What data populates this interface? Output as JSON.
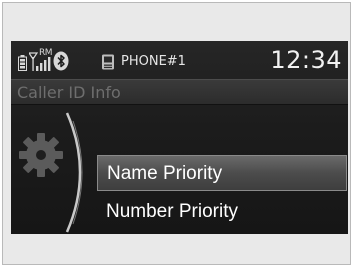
{
  "status_bar": {
    "roam_label": "RM",
    "phone_name": "PHONE#1",
    "time": "12:34",
    "icons": [
      "battery-icon",
      "signal-icon",
      "bluetooth-icon",
      "phone-icon"
    ]
  },
  "screen": {
    "title": "Caller ID Info",
    "settings_icon": "gear-icon"
  },
  "menu": {
    "items": [
      {
        "label": "Name Priority",
        "selected": true
      },
      {
        "label": "Number Priority",
        "selected": false
      }
    ]
  },
  "colors": {
    "screen_background": "#1c1c1c",
    "highlight": "#5a5a5a",
    "text": "#ffffff",
    "title_text": "#6e6e6e"
  }
}
